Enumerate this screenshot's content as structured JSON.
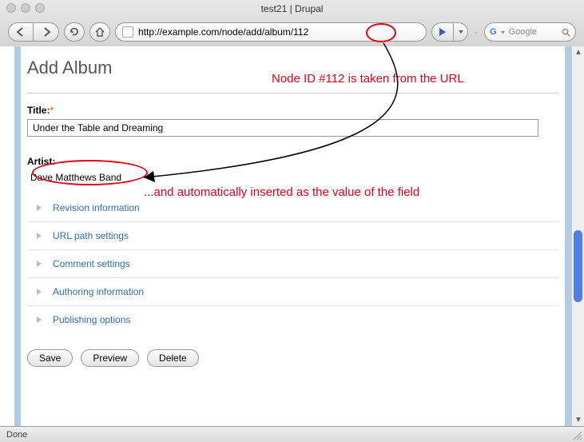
{
  "window": {
    "title": "test21 | Drupal"
  },
  "url": {
    "value": "http://example.com/node/add/album/112"
  },
  "search": {
    "icon": "G",
    "placeholder": "Google"
  },
  "page": {
    "heading": "Add Album",
    "title_label": "Title:",
    "title_value": "Under the Table and Dreaming",
    "artist_label": "Artist:",
    "artist_value": "Dave Matthews Band"
  },
  "fieldsets": [
    {
      "label": "Revision information"
    },
    {
      "label": "URL path settings"
    },
    {
      "label": "Comment settings"
    },
    {
      "label": "Authoring information"
    },
    {
      "label": "Publishing options"
    }
  ],
  "buttons": {
    "save": "Save",
    "preview": "Preview",
    "delete": "Delete"
  },
  "status": {
    "text": "Done"
  },
  "annotations": {
    "top": "Node ID #112 is taken from the URL",
    "bottom": "...and automatically inserted as the value of the field"
  }
}
